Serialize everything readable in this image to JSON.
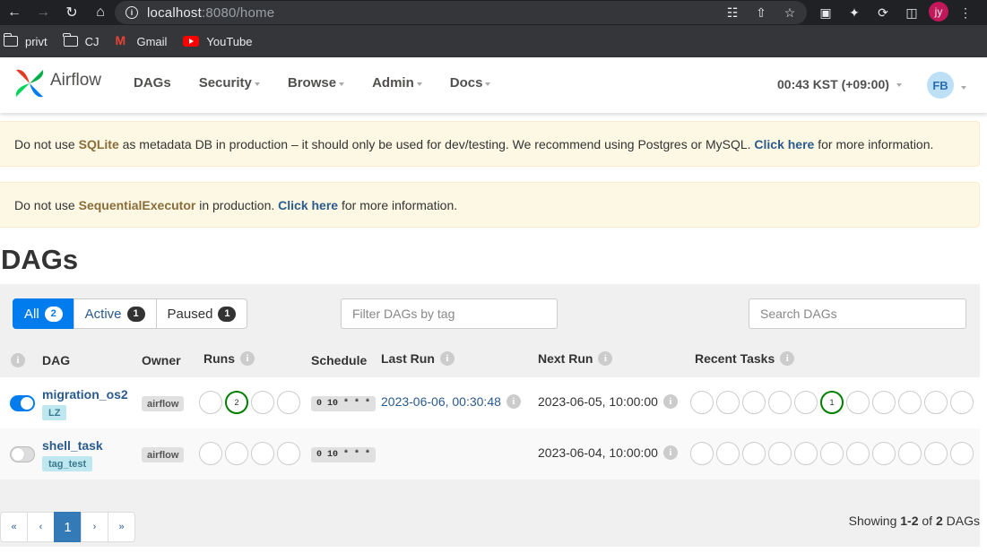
{
  "browser": {
    "url_host": "localhost",
    "url_port": ":8080/home",
    "profile_initials": "jy",
    "bookmarks": [
      {
        "label": "privt",
        "icon": "folder-icon"
      },
      {
        "label": "CJ",
        "icon": "folder-icon"
      },
      {
        "label": "Gmail",
        "icon": "gmail-icon"
      },
      {
        "label": "YouTube",
        "icon": "youtube-icon"
      }
    ]
  },
  "navbar": {
    "brand": "Airflow",
    "menu": [
      "DAGs",
      "Security",
      "Browse",
      "Admin",
      "Docs"
    ],
    "time": "00:43 KST (+09:00)",
    "user_initials": "FB"
  },
  "alerts": {
    "a1_pre": "Do not use ",
    "a1_bold": "SQLite",
    "a1_mid": " as metadata DB in production – it should only be used for dev/testing. We recommend using Postgres or MySQL. ",
    "a1_link": "Click here",
    "a1_post": " for more information.",
    "a2_pre": "Do not use ",
    "a2_bold": "SequentialExecutor",
    "a2_mid": " in production. ",
    "a2_link": "Click here",
    "a2_post": " for more information."
  },
  "page_title": "DAGs",
  "filters": {
    "all_label": "All",
    "all_count": "2",
    "active_label": "Active",
    "active_count": "1",
    "paused_label": "Paused",
    "paused_count": "1",
    "tag_placeholder": "Filter DAGs by tag",
    "search_placeholder": "Search DAGs"
  },
  "table": {
    "headers": {
      "dag": "DAG",
      "owner": "Owner",
      "runs": "Runs",
      "schedule": "Schedule",
      "last_run": "Last Run",
      "next_run": "Next Run",
      "recent_tasks": "Recent Tasks"
    },
    "rows": [
      {
        "name": "migration_os2",
        "tag": "LZ",
        "owner": "airflow",
        "schedule": "0 10 * * *",
        "last_run": "2023-06-06, 00:30:48",
        "next_run": "2023-06-05, 10:00:00",
        "runs_success": "2",
        "tasks_success": "1",
        "enabled": true
      },
      {
        "name": "shell_task",
        "tag": "tag_test",
        "owner": "airflow",
        "schedule": "0 10 * * *",
        "last_run": "",
        "next_run": "2023-06-04, 10:00:00",
        "runs_success": "",
        "tasks_success": "",
        "enabled": false
      }
    ]
  },
  "pagination": {
    "first": "«",
    "prev": "‹",
    "current": "1",
    "next": "›",
    "last": "»"
  },
  "showing": {
    "pre": "Showing ",
    "range": "1-2",
    "mid": " of ",
    "total": "2",
    "post": " DAGs"
  },
  "colors": {
    "accent": "#017cee",
    "success": "#008000",
    "alert_bg": "#fcf8e3"
  }
}
